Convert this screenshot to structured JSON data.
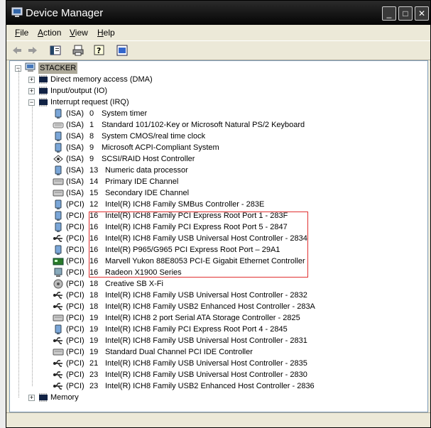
{
  "window": {
    "title": "Device Manager"
  },
  "menu": [
    {
      "label": "File",
      "accel": "F",
      "rest": "ile"
    },
    {
      "label": "Action",
      "accel": "A",
      "rest": "ction"
    },
    {
      "label": "View",
      "accel": "V",
      "rest": "iew"
    },
    {
      "label": "Help",
      "accel": "H",
      "rest": "elp"
    }
  ],
  "tree": {
    "root": "STACKER",
    "categories": {
      "dma": "Direct memory access (DMA)",
      "io": "Input/output (IO)",
      "irq": "Interrupt request (IRQ)",
      "memory": "Memory"
    },
    "irq_entries": [
      {
        "bus": "(ISA)",
        "irq": "0",
        "device": "System timer",
        "icon": "system-device-icon"
      },
      {
        "bus": "(ISA)",
        "irq": "1",
        "device": "Standard 101/102-Key or Microsoft Natural PS/2 Keyboard",
        "icon": "keyboard-icon"
      },
      {
        "bus": "(ISA)",
        "irq": "8",
        "device": "System CMOS/real time clock",
        "icon": "system-device-icon"
      },
      {
        "bus": "(ISA)",
        "irq": "9",
        "device": "Microsoft ACPI-Compliant System",
        "icon": "system-device-icon"
      },
      {
        "bus": "(ISA)",
        "irq": "9",
        "device": "SCSI/RAID Host Controller",
        "icon": "scsi-icon"
      },
      {
        "bus": "(ISA)",
        "irq": "13",
        "device": "Numeric data processor",
        "icon": "system-device-icon"
      },
      {
        "bus": "(ISA)",
        "irq": "14",
        "device": "Primary IDE Channel",
        "icon": "ide-icon"
      },
      {
        "bus": "(ISA)",
        "irq": "15",
        "device": "Secondary IDE Channel",
        "icon": "ide-icon"
      },
      {
        "bus": "(PCI)",
        "irq": "12",
        "device": "Intel(R) ICH8 Family SMBus Controller - 283E",
        "icon": "system-device-icon"
      },
      {
        "bus": "(PCI)",
        "irq": "16",
        "device": "Intel(R) ICH8 Family PCI Express Root Port 1 - 283F",
        "icon": "system-device-icon"
      },
      {
        "bus": "(PCI)",
        "irq": "16",
        "device": "Intel(R) ICH8 Family PCI Express Root Port 5 - 2847",
        "icon": "system-device-icon"
      },
      {
        "bus": "(PCI)",
        "irq": "16",
        "device": "Intel(R) ICH8 Family USB Universal Host Controller - 2834",
        "icon": "usb-icon"
      },
      {
        "bus": "(PCI)",
        "irq": "16",
        "device": "Intel(R) P965/G965 PCI Express Root Port – 29A1",
        "icon": "system-device-icon"
      },
      {
        "bus": "(PCI)",
        "irq": "16",
        "device": "Marvell Yukon 88E8053 PCI-E Gigabit Ethernet Controller",
        "icon": "network-card-icon"
      },
      {
        "bus": "(PCI)",
        "irq": "16",
        "device": "Radeon X1900 Series",
        "icon": "display-adapter-icon"
      },
      {
        "bus": "(PCI)",
        "irq": "18",
        "device": "Creative SB X-Fi",
        "icon": "sound-icon"
      },
      {
        "bus": "(PCI)",
        "irq": "18",
        "device": "Intel(R) ICH8 Family USB Universal Host Controller - 2832",
        "icon": "usb-icon"
      },
      {
        "bus": "(PCI)",
        "irq": "18",
        "device": "Intel(R) ICH8 Family USB2 Enhanced Host Controller - 283A",
        "icon": "usb-icon"
      },
      {
        "bus": "(PCI)",
        "irq": "19",
        "device": "Intel(R) ICH8 2 port Serial ATA Storage Controller - 2825",
        "icon": "ide-icon"
      },
      {
        "bus": "(PCI)",
        "irq": "19",
        "device": "Intel(R) ICH8 Family PCI Express Root Port 4 - 2845",
        "icon": "system-device-icon"
      },
      {
        "bus": "(PCI)",
        "irq": "19",
        "device": "Intel(R) ICH8 Family USB Universal Host Controller - 2831",
        "icon": "usb-icon"
      },
      {
        "bus": "(PCI)",
        "irq": "19",
        "device": "Standard Dual Channel PCI IDE Controller",
        "icon": "ide-icon"
      },
      {
        "bus": "(PCI)",
        "irq": "21",
        "device": "Intel(R) ICH8 Family USB Universal Host Controller - 2835",
        "icon": "usb-icon"
      },
      {
        "bus": "(PCI)",
        "irq": "23",
        "device": "Intel(R) ICH8 Family USB Universal Host Controller - 2830",
        "icon": "usb-icon"
      },
      {
        "bus": "(PCI)",
        "irq": "23",
        "device": "Intel(R) ICH8 Family USB2 Enhanced Host Controller - 2836",
        "icon": "usb-icon"
      }
    ]
  },
  "colors": {
    "highlight_box": "#e03030",
    "titlebar": "#050505"
  }
}
